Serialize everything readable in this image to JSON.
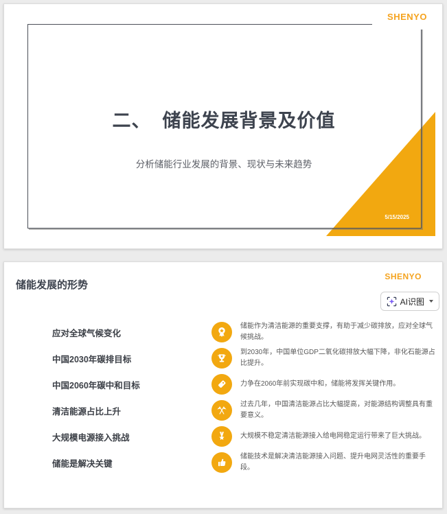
{
  "colors": {
    "accent_yellow": "#F2A810",
    "logo_orange": "#F5A31E",
    "sparkle_purple": "#7B5CF5",
    "title_dark": "#3D434E",
    "desc_gray": "#595959"
  },
  "slide1": {
    "logo": "SHENYO",
    "title": "二、  储能发展背景及价值",
    "subtitle": "分析储能行业发展的背景、现状与未来趋势",
    "date": "5/15/2025",
    "decor": {
      "corner_triangle": "corner-triangle",
      "frame": "thin-border-frame"
    }
  },
  "slide2": {
    "logo": "SHENYO",
    "title": "储能发展的形势",
    "ai_button": {
      "icon": "scan-sparkle-icon",
      "label": "AI识图",
      "chevron": "chevron-down-icon"
    },
    "rows": [
      {
        "label": "应对全球气候变化",
        "icon": "rosette-award-icon",
        "desc": "储能作为清洁能源的重要支撑，有助于减少碳排放，应对全球气候挑战。"
      },
      {
        "label": "中国2030年碳排目标",
        "icon": "trophy-icon",
        "desc": "到2030年，中国单位GDP二氧化碳排放大幅下降，非化石能源占比提升。"
      },
      {
        "label": "中国2060年碳中和目标",
        "icon": "tag-icon",
        "desc": "力争在2060年前实现碳中和，储能将发挥关键作用。"
      },
      {
        "label": "清洁能源占比上升",
        "icon": "crossed-flags-icon",
        "desc": "过去几年，中国清洁能源占比大幅提高，对能源结构调整具有重要意义。"
      },
      {
        "label": "大规模电源接入挑战",
        "icon": "medal-icon",
        "desc": "大规模不稳定清洁能源接入给电网稳定运行带来了巨大挑战。"
      },
      {
        "label": "储能是解决关键",
        "icon": "thumbs-up-icon",
        "desc": "储能技术是解决清洁能源接入问题、提升电网灵活性的重要手段。"
      }
    ]
  }
}
